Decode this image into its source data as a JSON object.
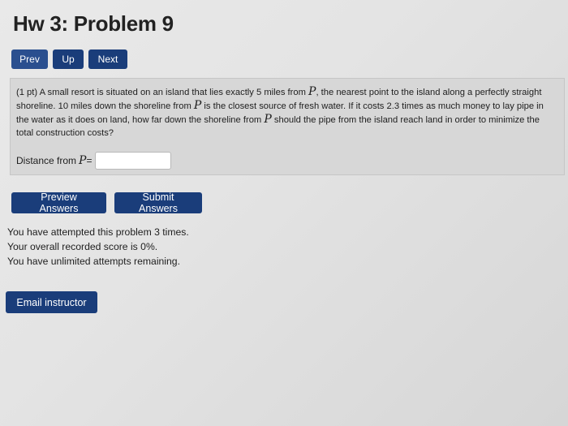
{
  "header": {
    "title": "Hw 3: Problem 9"
  },
  "nav": {
    "prev_label": "Prev",
    "up_label": "Up",
    "next_label": "Next"
  },
  "problem": {
    "intro": "(1 pt) A small resort is situated on an island that lies exactly 5 miles from ",
    "var": "P",
    "mid1": ", the nearest point to the island along a perfectly straight shoreline. 10 miles down the shoreline from ",
    "mid2": " is the closest source of fresh water. If it costs 2.3 times as much money to lay pipe in the water as it does on land, how far down the shoreline from ",
    "end": " should the pipe from the island reach land in order to minimize the total construction costs?",
    "answer_label": "Distance from ",
    "answer_eq": " =",
    "answer_value": ""
  },
  "actions": {
    "preview_label": "Preview Answers",
    "submit_label": "Submit Answers"
  },
  "status": {
    "line1": "You have attempted this problem 3 times.",
    "line2": "Your overall recorded score is 0%.",
    "line3": "You have unlimited attempts remaining."
  },
  "email": {
    "label": "Email instructor"
  },
  "colors": {
    "button_bg": "#1a3d7a",
    "panel_bg": "#d7d7d7"
  }
}
